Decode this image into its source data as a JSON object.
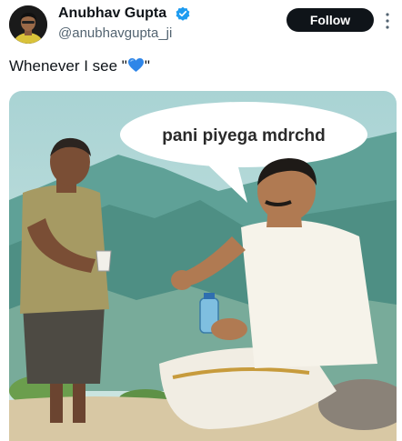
{
  "author": {
    "display_name": "Anubhav Gupta",
    "handle": "@anubhavgupta_ji",
    "verified": true,
    "avatar_icon": "avatar-photo"
  },
  "actions": {
    "follow_label": "Follow",
    "more_icon": "more-dots-icon"
  },
  "tweet": {
    "text_before": "Whenever I see \"",
    "emoji": "blue-heart-emoji",
    "text_after": "\""
  },
  "media": {
    "speech_bubble_text": "pani piyega mdrchd"
  },
  "colors": {
    "accent_blue": "#1d9bf0",
    "follow_bg": "#0f1419",
    "handle_gray": "#536471",
    "heart_blue": "#2f86e8"
  }
}
